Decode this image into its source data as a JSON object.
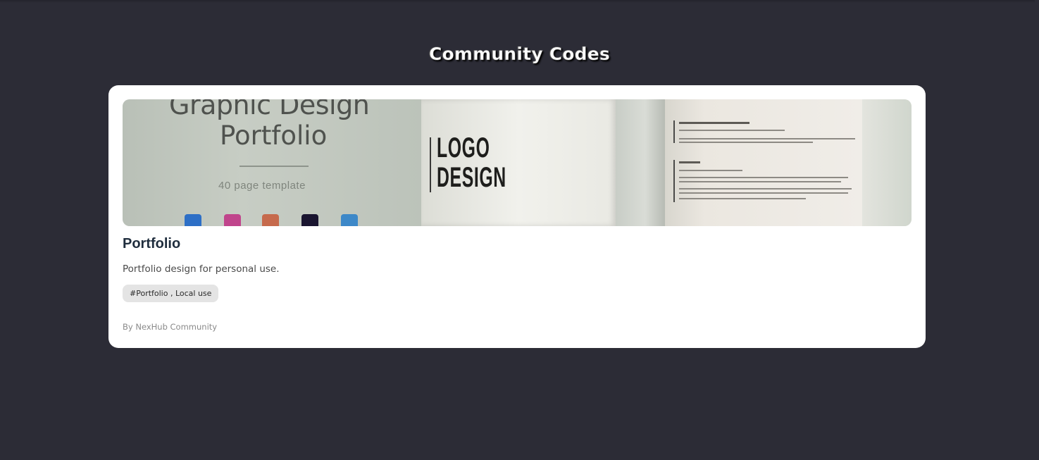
{
  "page": {
    "title": "Community Codes",
    "background": "#2c2c36"
  },
  "card": {
    "title": "Portfolio",
    "description": "Portfolio design for personal use.",
    "tags": "#Portfolio , Local use",
    "author": "By NexHub Community",
    "thumbnail": {
      "left_heading_line1": "Graphic Design",
      "left_heading_line2": "Portfolio",
      "left_caption": "40 page template",
      "logo_text_line1": "LOGO",
      "logo_text_line2": "DESIGN",
      "app_icons": [
        "photoshop-icon",
        "indesign-icon",
        "illustrator-icon",
        "premiere-icon",
        "lightroom-icon"
      ]
    }
  }
}
